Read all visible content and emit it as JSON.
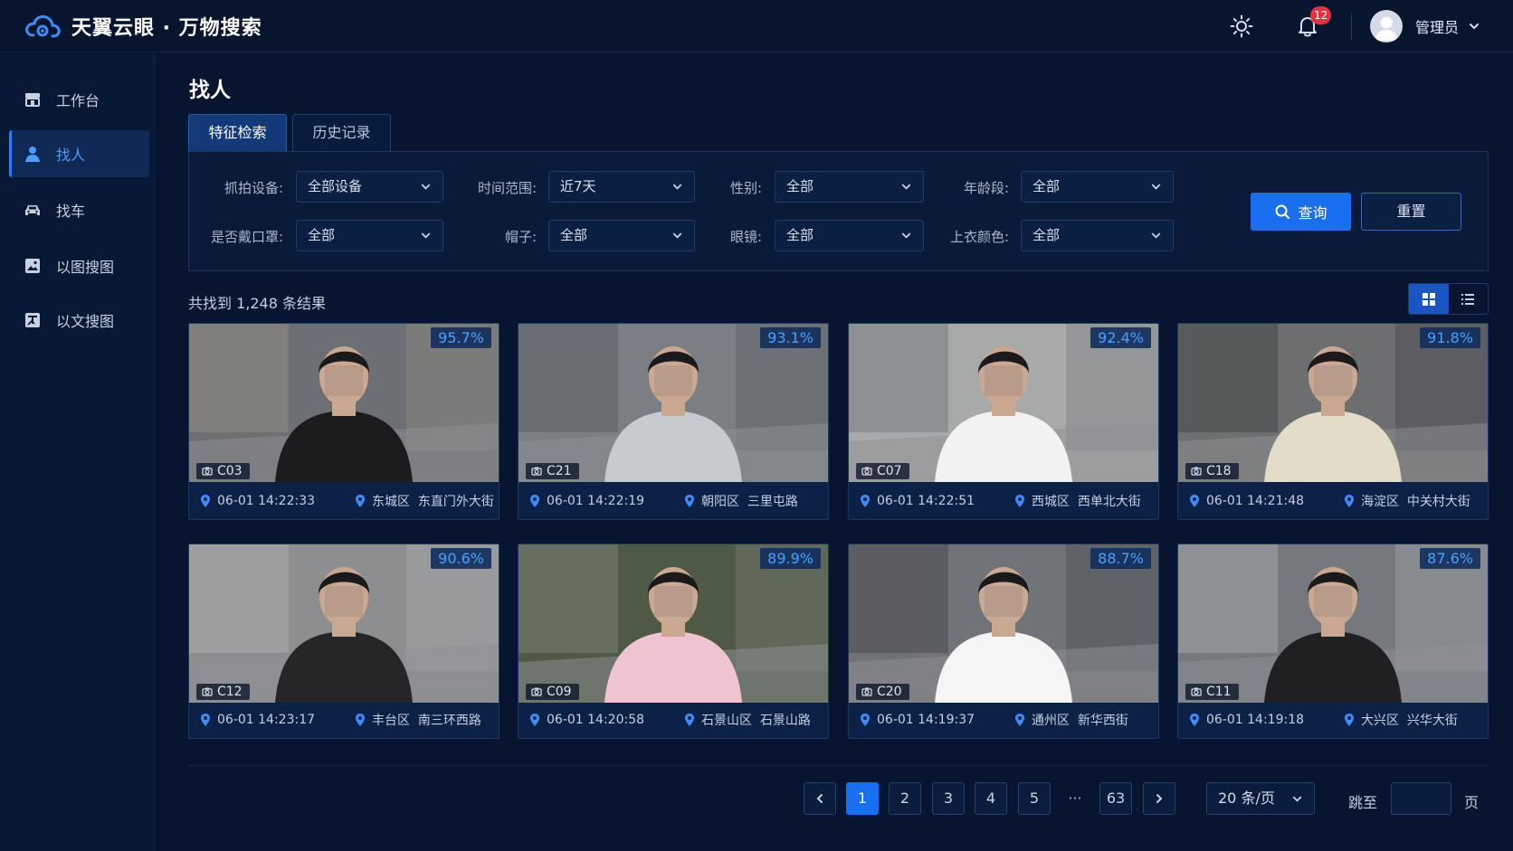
{
  "app": {
    "title": "天翼云眼 · 万物搜索"
  },
  "header": {
    "notification_count": "12",
    "username": "管理员"
  },
  "sidebar": {
    "items": [
      {
        "label": "工作台",
        "icon": "workbench-icon",
        "active": false
      },
      {
        "label": "找人",
        "icon": "person-icon",
        "active": true
      },
      {
        "label": "找车",
        "icon": "car-icon",
        "active": false
      },
      {
        "label": "以图搜图",
        "icon": "image-search-icon",
        "active": false
      },
      {
        "label": "以文搜图",
        "icon": "text-search-icon",
        "active": false
      }
    ]
  },
  "page": {
    "title": "找人"
  },
  "tabs": [
    {
      "label": "特征检索",
      "active": true
    },
    {
      "label": "历史记录",
      "active": false
    }
  ],
  "filters": {
    "device": {
      "label": "抓拍设备:",
      "value": "全部设备"
    },
    "time": {
      "label": "时间范围:",
      "value": "近7天"
    },
    "gender": {
      "label": "性别:",
      "value": "全部"
    },
    "age": {
      "label": "年龄段:",
      "value": "全部"
    },
    "mask": {
      "label": "是否戴口罩:",
      "value": "全部"
    },
    "hat": {
      "label": "帽子:",
      "value": "全部"
    },
    "glasses": {
      "label": "眼镜:",
      "value": "全部"
    },
    "top_color": {
      "label": "上衣颜色:",
      "value": "全部"
    }
  },
  "actions": {
    "query": "查询",
    "reset": "重置"
  },
  "results": {
    "summary": "共找到 1,248 条结果",
    "view": "grid",
    "cards": [
      {
        "score": "95.7%",
        "camera": "C03",
        "time": "06-01 14:22:33",
        "location": "东城区  东直门外大街"
      },
      {
        "score": "93.1%",
        "camera": "C21",
        "time": "06-01 14:22:19",
        "location": "朝阳区  三里屯路"
      },
      {
        "score": "92.4%",
        "camera": "C07",
        "time": "06-01 14:22:51",
        "location": "西城区  西单北大街"
      },
      {
        "score": "91.8%",
        "camera": "C18",
        "time": "06-01 14:21:48",
        "location": "海淀区  中关村大街"
      },
      {
        "score": "90.6%",
        "camera": "C12",
        "time": "06-01 14:23:17",
        "location": "丰台区  南三环西路"
      },
      {
        "score": "89.9%",
        "camera": "C09",
        "time": "06-01 14:20:58",
        "location": "石景山区  石景山路"
      },
      {
        "score": "88.7%",
        "camera": "C20",
        "time": "06-01 14:19:37",
        "location": "通州区  新华西街"
      },
      {
        "score": "87.6%",
        "camera": "C11",
        "time": "06-01 14:19:18",
        "location": "大兴区  兴华大街"
      }
    ]
  },
  "pagination": {
    "pages": [
      "1",
      "2",
      "3",
      "4",
      "5"
    ],
    "current": "1",
    "ellipsis": "···",
    "last": "63",
    "page_size": "20 条/页",
    "jump_label": "跳至",
    "page_unit": "页"
  },
  "colors": {
    "accent": "#1a6ff0",
    "background": "#071530",
    "score_text": "#4aa0ff",
    "badge": "#e5323e"
  }
}
